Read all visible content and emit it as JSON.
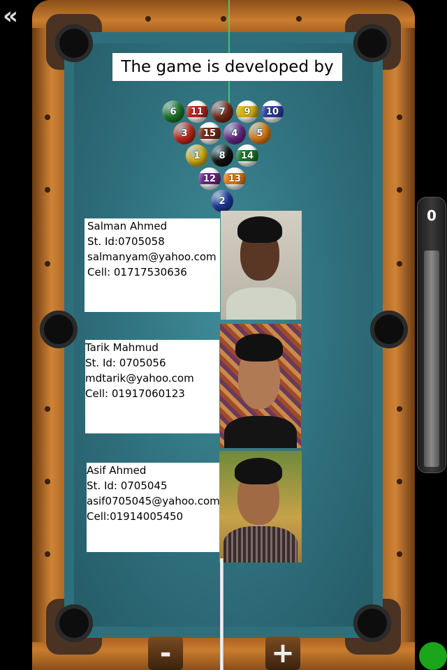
{
  "header": {
    "title": "The game is developed by"
  },
  "power_meter": {
    "value": "0"
  },
  "controls": {
    "minus_label": "-",
    "plus_label": "+"
  },
  "nav": {
    "back_icon": "double-chevron-left-icon"
  },
  "balls": [
    {
      "n": "6",
      "color": "#1e7a2c",
      "stripe": false
    },
    {
      "n": "11",
      "color": "#b52a1d",
      "stripe": true
    },
    {
      "n": "7",
      "color": "#7a2a1a",
      "stripe": false
    },
    {
      "n": "9",
      "color": "#d8b316",
      "stripe": true
    },
    {
      "n": "10",
      "color": "#2a3fa8",
      "stripe": true
    },
    {
      "n": "3",
      "color": "#c8281c",
      "stripe": false
    },
    {
      "n": "15",
      "color": "#7a2a1a",
      "stripe": true
    },
    {
      "n": "4",
      "color": "#6a2a8a",
      "stripe": false
    },
    {
      "n": "5",
      "color": "#e07d14",
      "stripe": false
    },
    {
      "n": "1",
      "color": "#d8b316",
      "stripe": false
    },
    {
      "n": "8",
      "color": "#111111",
      "stripe": false
    },
    {
      "n": "14",
      "color": "#1e7a2c",
      "stripe": true
    },
    {
      "n": "12",
      "color": "#6a2a8a",
      "stripe": true
    },
    {
      "n": "13",
      "color": "#e07d14",
      "stripe": true
    },
    {
      "n": "2",
      "color": "#1f3aa0",
      "stripe": false
    }
  ],
  "developers": [
    {
      "name": "Salman Ahmed",
      "id": "St. Id:0705058",
      "email": "salmanyam@yahoo.com",
      "cell": "Cell: 01717530636"
    },
    {
      "name": "Tarik Mahmud",
      "id": "St. Id: 0705056",
      "email": "mdtarik@yahoo.com",
      "cell": "Cell: 01917060123"
    },
    {
      "name": "Asif Ahmed",
      "id": "St. Id: 0705045",
      "email": "asif0705045@yahoo.com",
      "cell": "Cell:01914005450"
    }
  ]
}
